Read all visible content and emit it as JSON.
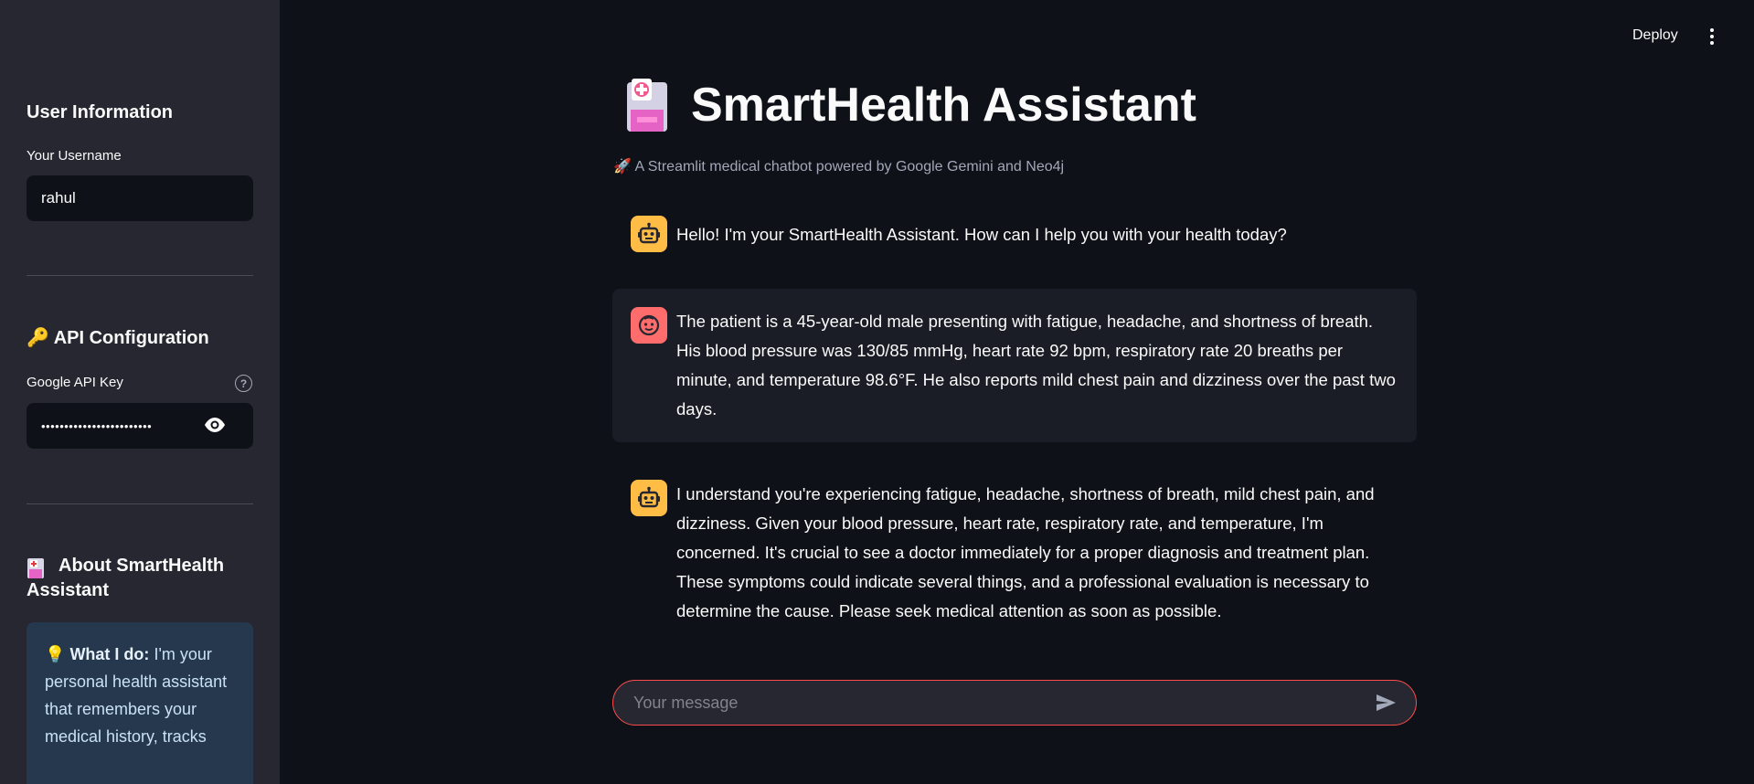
{
  "sidebar": {
    "user_section_title": "User Information",
    "username_label": "Your Username",
    "username_value": "rahul",
    "api_section_title": "🔑 API Configuration",
    "api_key_label": "Google API Key",
    "api_key_masked": "••••••••••••••••••••••••",
    "about_title": "About SmartHealth Assistant",
    "about_box": {
      "bold": "What I do:",
      "text": "I'm your personal health assistant that remembers your medical history, tracks"
    }
  },
  "header": {
    "deploy_label": "Deploy"
  },
  "main": {
    "title": "SmartHealth Assistant",
    "subtitle": "🚀 A Streamlit medical chatbot powered by Google Gemini and Neo4j",
    "messages": [
      {
        "role": "assistant",
        "text": "Hello! I'm your SmartHealth Assistant. How can I help you with your health today?"
      },
      {
        "role": "user",
        "text": "The patient is a 45-year-old male presenting with fatigue, headache, and shortness of breath. His blood pressure was 130/85 mmHg, heart rate 92 bpm, respiratory rate 20 breaths per minute, and temperature 98.6°F. He also reports mild chest pain and dizziness over the past two days."
      },
      {
        "role": "assistant",
        "text": "I understand you're experiencing fatigue, headache, shortness of breath, mild chest pain, and dizziness. Given your blood pressure, heart rate, respiratory rate, and temperature, I'm concerned. It's crucial to see a doctor immediately for a proper diagnosis and treatment plan. These symptoms could indicate several things, and a professional evaluation is necessary to determine the cause. Please seek medical attention as soon as possible."
      }
    ],
    "chat_input_placeholder": "Your message"
  },
  "colors": {
    "background": "#0e1117",
    "sidebar": "#262730",
    "accent": "#ff4b4b",
    "bot_avatar": "#ffbd45",
    "user_avatar": "#ff6c6c",
    "info_box": "#26384e"
  },
  "icons": {
    "title": "hospital-icon",
    "about": "hospital-icon",
    "bot_avatar": "robot-face-icon",
    "user_avatar": "face-icon",
    "send": "send-icon",
    "menu": "kebab-menu-icon",
    "visibility": "eye-icon",
    "help": "help-circle-icon",
    "tip": "lightbulb-icon"
  }
}
